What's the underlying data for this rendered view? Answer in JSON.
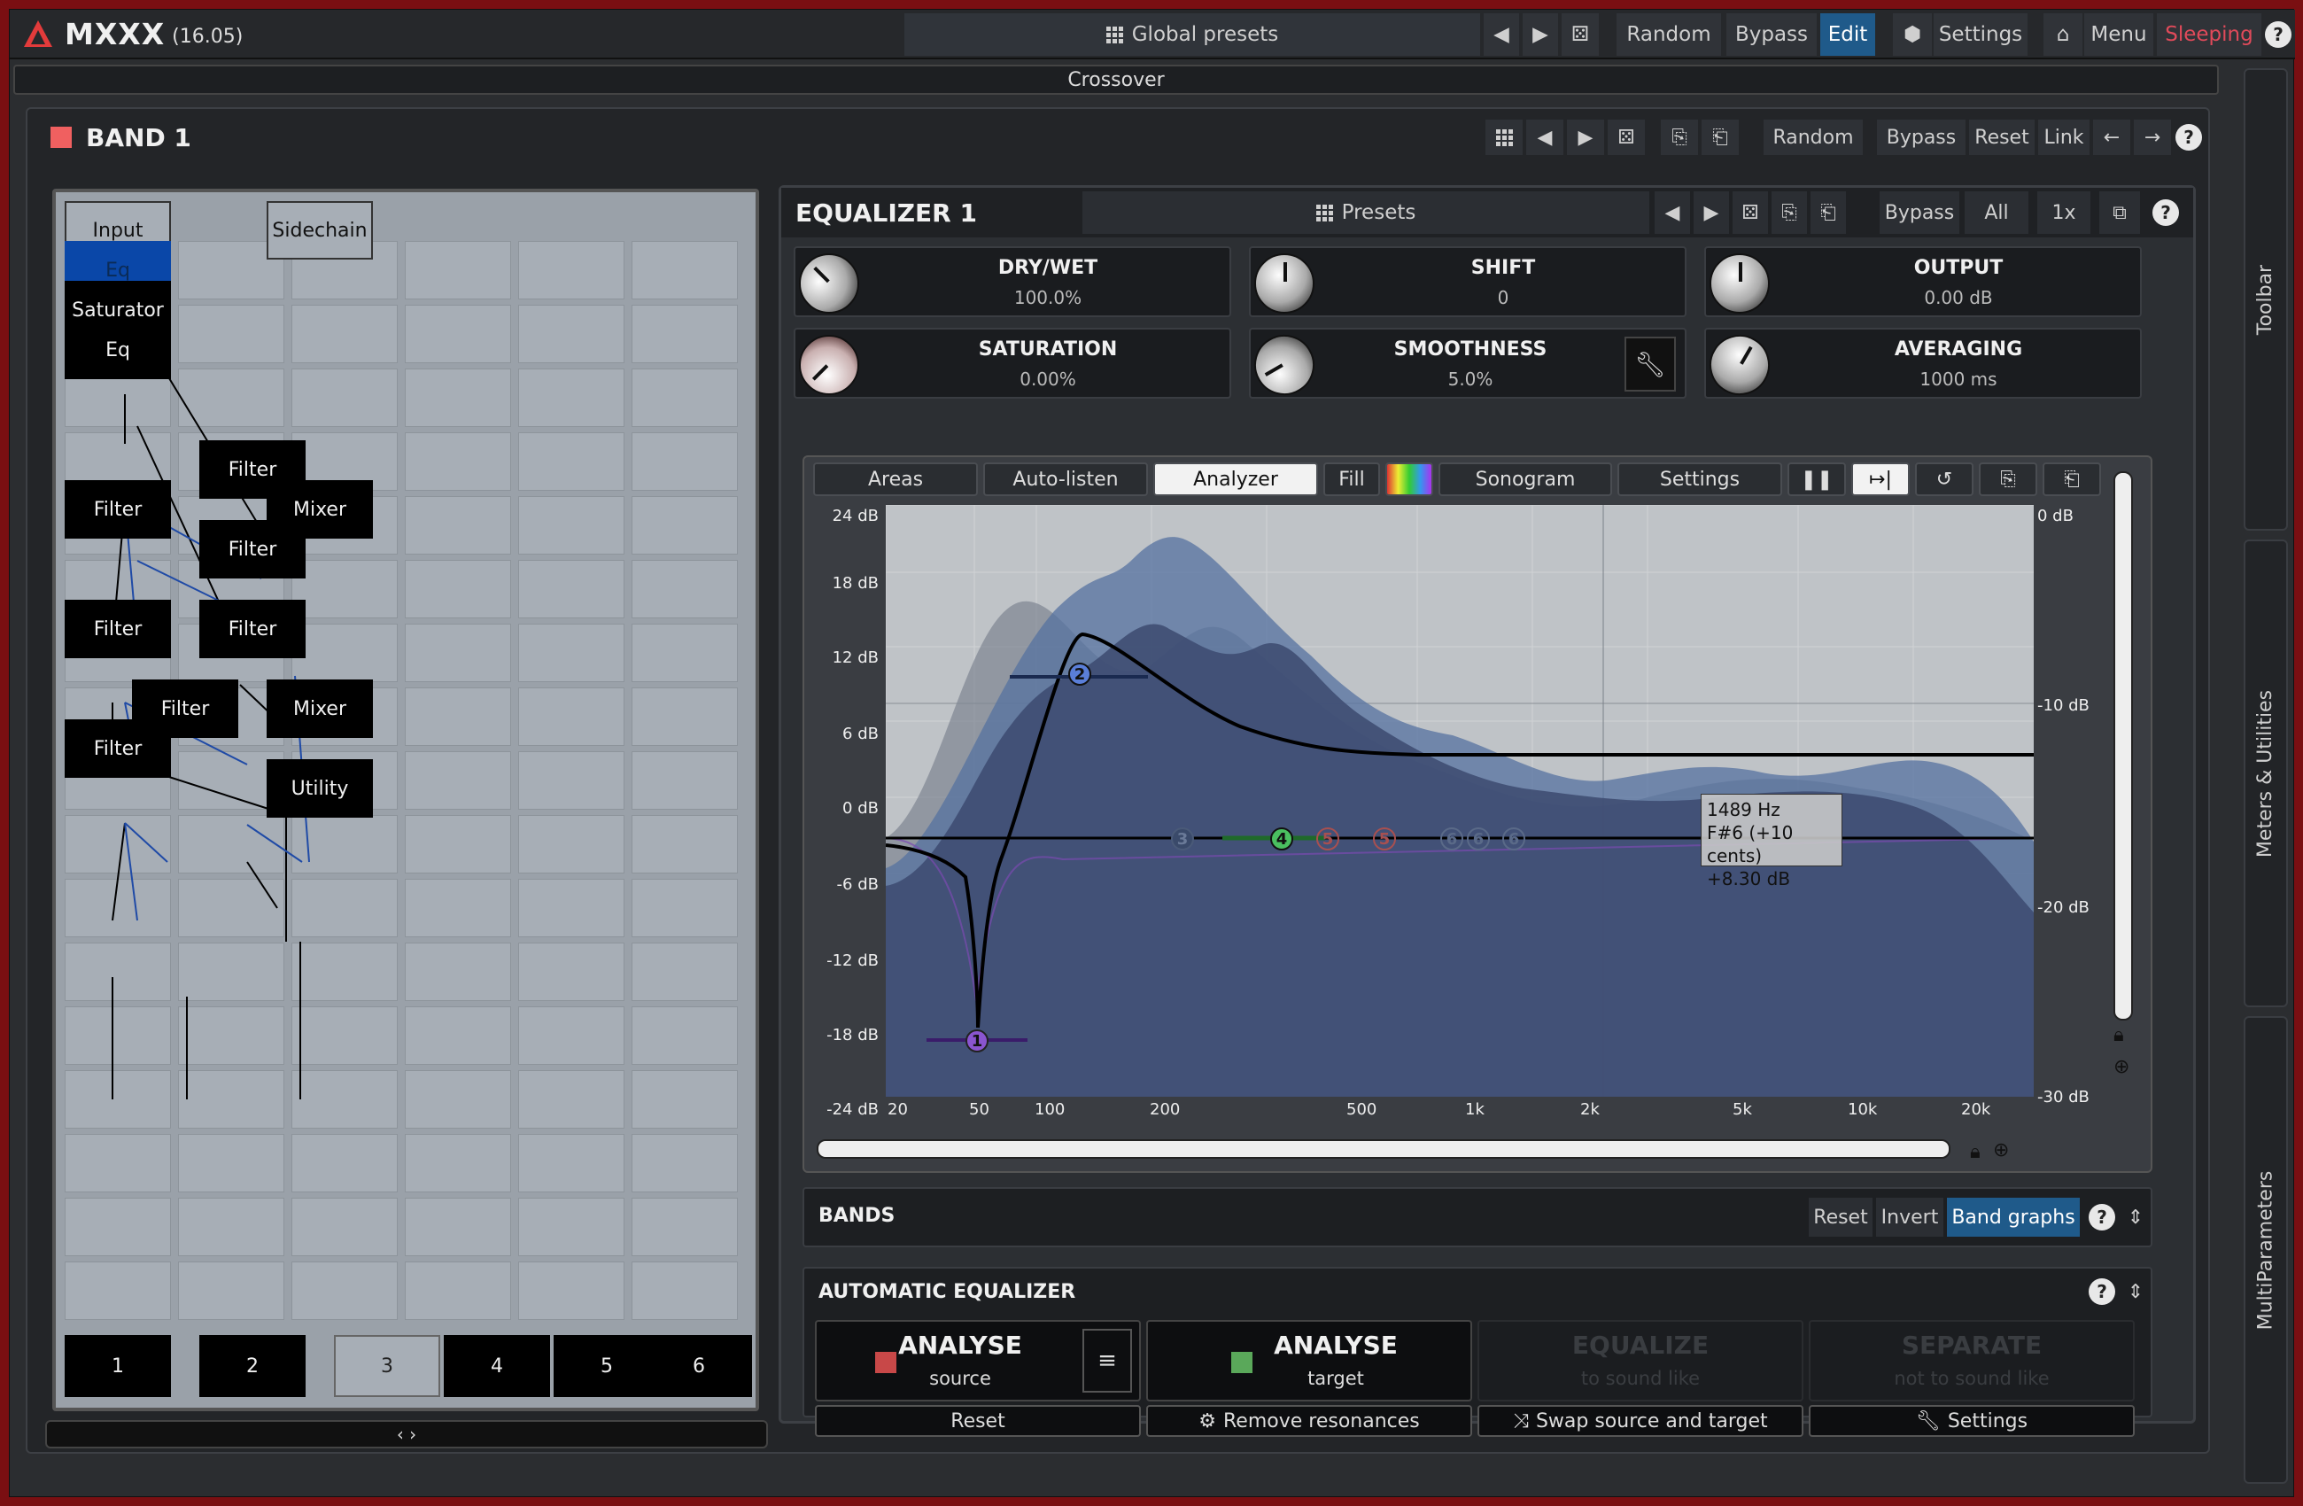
{
  "topbar": {
    "app_name": "MXXX",
    "version": "(16.05)",
    "global_presets": "Global presets",
    "random": "Random",
    "bypass": "Bypass",
    "edit": "Edit",
    "settings": "Settings",
    "menu": "Menu",
    "sleeping": "Sleeping",
    "help": "?"
  },
  "crossover": "Crossover",
  "side_tabs": [
    "Toolbar",
    "Meters & Utilities",
    "MultiParameters"
  ],
  "band": {
    "title": "BAND 1",
    "random": "Random",
    "bypass": "Bypass",
    "reset": "Reset",
    "link": "Link",
    "help": "?"
  },
  "routing": {
    "input": "Input",
    "sidechain": "Sidechain",
    "nodes": [
      "Eq",
      "Saturator",
      "Eq",
      "Filter",
      "Filter",
      "Mixer",
      "Filter",
      "Filter",
      "Filter",
      "Filter",
      "Mixer",
      "Filter",
      "Utility"
    ],
    "outputs": [
      "1",
      "2",
      "3",
      "4",
      "5",
      "6"
    ],
    "scroll_label": "‹ ›"
  },
  "equalizer": {
    "title": "EQUALIZER 1",
    "presets": "Presets",
    "bypass": "Bypass",
    "all": "All",
    "oversampling": "1x",
    "help": "?",
    "params": [
      {
        "name": "DRY/WET",
        "value": "100.0%"
      },
      {
        "name": "SHIFT",
        "value": "0"
      },
      {
        "name": "OUTPUT",
        "value": "0.00 dB"
      },
      {
        "name": "SATURATION",
        "value": "0.00%"
      },
      {
        "name": "SMOOTHNESS",
        "value": "5.0%"
      },
      {
        "name": "AVERAGING",
        "value": "1000 ms"
      }
    ],
    "graph_tabs": [
      "Areas",
      "Auto-listen",
      "Analyzer",
      "Fill",
      "Sonogram",
      "Settings"
    ],
    "y_labels_left": [
      "24 dB",
      "18 dB",
      "12 dB",
      "6 dB",
      "0 dB",
      "-6 dB",
      "-12 dB",
      "-18 dB",
      "-24 dB"
    ],
    "y_labels_right": [
      "0 dB",
      "-10 dB",
      "-20 dB",
      "-30 dB"
    ],
    "x_labels": [
      "20",
      "50",
      "100",
      "200",
      "500",
      "1k",
      "2k",
      "5k",
      "10k",
      "20k"
    ],
    "band_points": [
      "1",
      "2",
      "3",
      "4",
      "5",
      "5",
      "6",
      "6",
      "6"
    ],
    "tooltip": {
      "freq": "1489 Hz",
      "note": "F#6 (+10 cents)",
      "gain": "+8.30 dB"
    }
  },
  "bands_section": {
    "title": "BANDS",
    "reset": "Reset",
    "invert": "Invert",
    "band_graphs": "Band graphs",
    "help": "?"
  },
  "auto_eq": {
    "title": "AUTOMATIC EQUALIZER",
    "help": "?",
    "analyse_source": "ANALYSE",
    "source_sub": "source",
    "menu_glyph": "≡",
    "analyse_target": "ANALYSE",
    "target_sub": "target",
    "equalize": "EQUALIZE",
    "equalize_sub": "to sound like",
    "separate": "SEPARATE",
    "separate_sub": "not to sound like",
    "reset": "Reset",
    "remove_resonances": "Remove resonances",
    "swap": "Swap source and target",
    "settings": "Settings"
  },
  "colors": {
    "accent_blue": "#1f5a8a",
    "sleeping_red": "#e04a5a",
    "band_swatch": "#f06060",
    "source_swatch": "#c84848",
    "target_swatch": "#5aa85a"
  }
}
